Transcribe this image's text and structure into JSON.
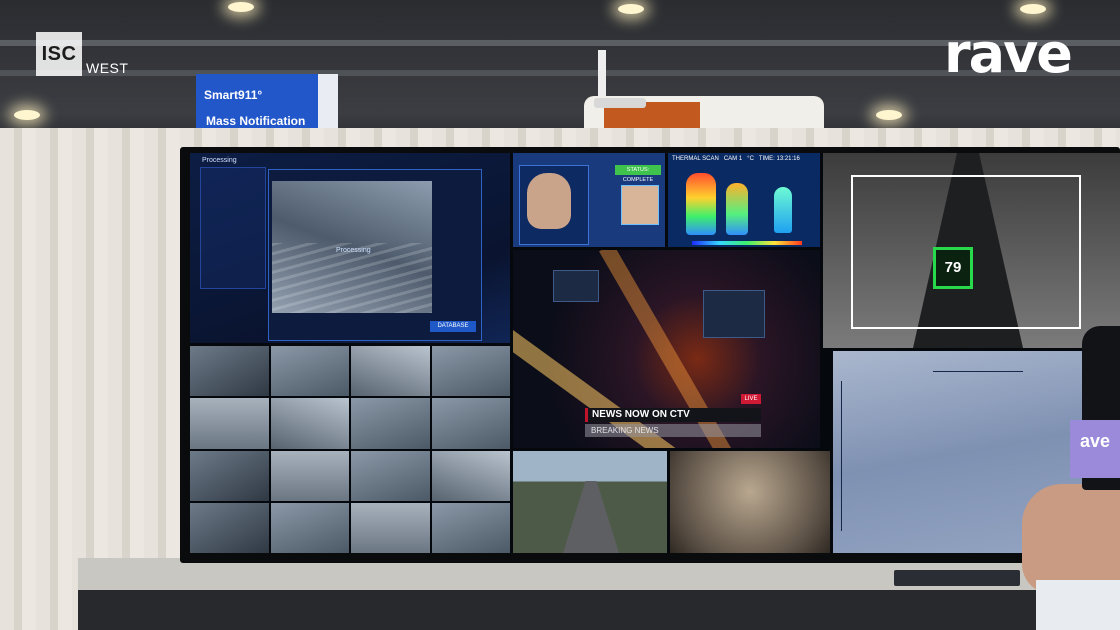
{
  "scene": {
    "event_logo": {
      "iso_mark": "ISC",
      "suffix": "WEST"
    },
    "channel_logo": "rave",
    "mic_flag": "ave",
    "booth_sign": {
      "line1": "Smart911°",
      "line2": "Mass Notification"
    }
  },
  "video_wall": {
    "processing_panel": {
      "title": "Processing",
      "overlay_text": "Processing",
      "button": "DATABASE"
    },
    "biometrics_panel": {
      "status": "STATUS: COMPLETE"
    },
    "thermal_panel": {
      "label": "THERMAL SCAN",
      "cam": "CAM 1",
      "unit": "°C",
      "time": "TIME: 13:21:16"
    },
    "news_panel": {
      "headline": "NEWS NOW ON CTV",
      "ticker": "BREAKING NEWS",
      "badge": "LIVE"
    },
    "road_panel": {
      "speed": "79"
    }
  }
}
